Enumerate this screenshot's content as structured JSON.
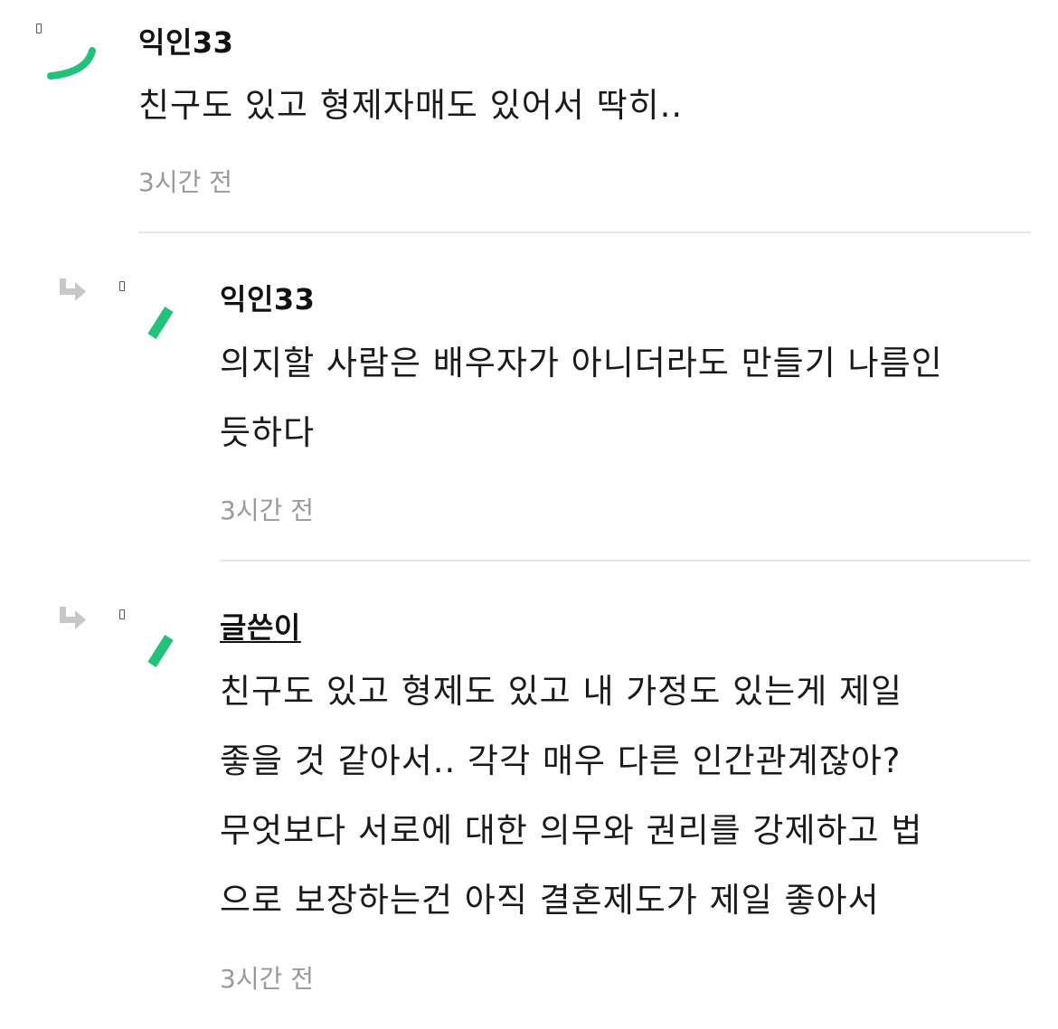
{
  "comments": [
    {
      "author": "익인33",
      "lines": [
        "친구도 있고 형제자매도 있어서 딱히.."
      ],
      "time": "3시간 전",
      "is_reply": false
    },
    {
      "author": "익인33",
      "lines": [
        "의지할 사람은 배우자가 아니더라도 만들기 나름인",
        "듯하다"
      ],
      "time": "3시간 전",
      "is_reply": true
    },
    {
      "author": "글쓴이",
      "lines": [
        "친구도 있고 형제도 있고 내 가정도 있는게 제일",
        "좋을 것 같아서.. 각각 매우 다른 인간관계잖아?",
        "무엇보다 서로에 대한 의무와 권리를 강제하고 법",
        "으로 보장하는건 아직 결혼제도가 제일 좋아서"
      ],
      "time": "3시간 전",
      "is_reply": true
    }
  ],
  "colors": {
    "accent": "#22c27a",
    "arrow": "#c8c8c8",
    "time": "#9a9a9a",
    "divider": "#e6e6e6"
  },
  "icons": {
    "reply": "reply-arrow-icon",
    "avatar": "avatar-mark-icon"
  }
}
